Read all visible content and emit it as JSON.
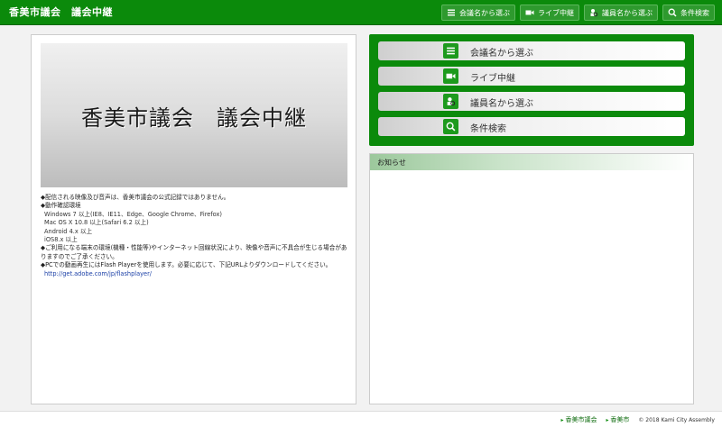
{
  "header": {
    "site_title": "香美市議会　議会中継",
    "nav": [
      {
        "label": "会議名から選ぶ",
        "icon": "list-icon"
      },
      {
        "label": "ライブ中継",
        "icon": "video-camera-icon"
      },
      {
        "label": "議員名から選ぶ",
        "icon": "member-search-icon"
      },
      {
        "label": "条件検索",
        "icon": "search-icon"
      }
    ]
  },
  "banner": {
    "title": "香美市議会　議会中継"
  },
  "notes": {
    "line1": "◆配信される映像及び音声は、香美市議会の公式記録ではありません。",
    "line2": "◆動作確認環境",
    "env1": "Windows 7 以上(IE8、IE11、Edge、Google Chrome、Firefox)",
    "env2": "Mac OS X 10.8 以上(Safari 6.2 以上)",
    "env3": "Android 4.x 以上",
    "env4": "iOS8.x 以上",
    "line3": "◆ご利用になる端末の環境(機種・性能等)やインターネット回線状況により、映像や音声に不具合が生じる場合がありますのでご了承ください。",
    "line4": "◆PCでの動画再生にはFlash Playerを使用します。必要に応じて、下記URLよりダウンロードしてください。",
    "link": "http://get.adobe.com/jp/flashplayer/"
  },
  "menu": [
    {
      "label": "会議名から選ぶ",
      "icon": "list-icon"
    },
    {
      "label": "ライブ中継",
      "icon": "video-camera-icon"
    },
    {
      "label": "議員名から選ぶ",
      "icon": "member-search-icon"
    },
    {
      "label": "条件検索",
      "icon": "search-icon"
    }
  ],
  "news": {
    "heading": "お知らせ"
  },
  "footer": {
    "link1": "香美市議会",
    "link2": "香美市",
    "copyright": "© 2018 Kami City Assembly"
  },
  "colors": {
    "brand_green": "#0b8a0b",
    "link_blue": "#1a3fa6"
  }
}
